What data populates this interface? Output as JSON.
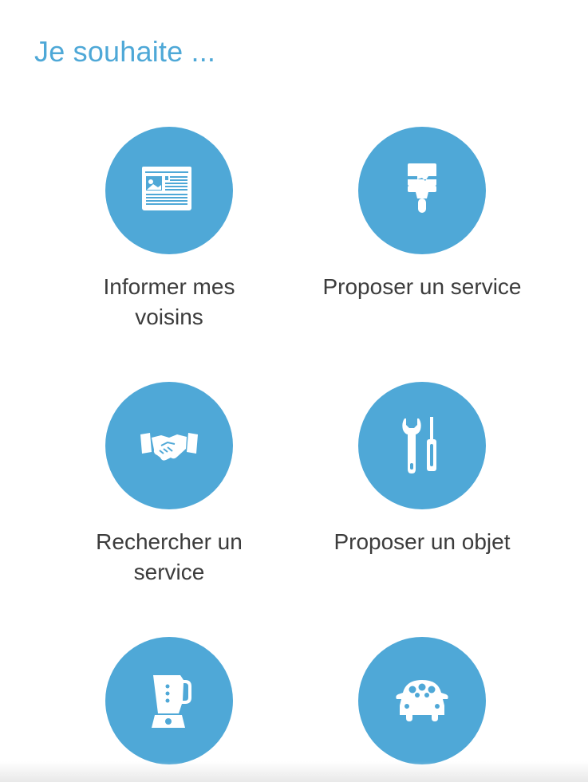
{
  "header": {
    "title": "Je souhaite ..."
  },
  "accent_color": "#4fa8d7",
  "actions": [
    {
      "label": "Informer mes voisins",
      "icon": "newspaper-icon"
    },
    {
      "label": "Proposer un service",
      "icon": "paint-brush-icon"
    },
    {
      "label": "Rechercher un service",
      "icon": "handshake-icon"
    },
    {
      "label": "Proposer un objet",
      "icon": "tools-icon"
    },
    {
      "label": "",
      "icon": "blender-icon"
    },
    {
      "label": "",
      "icon": "car-icon"
    }
  ]
}
